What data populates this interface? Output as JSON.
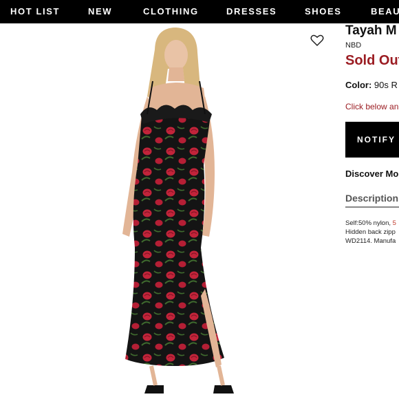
{
  "nav": {
    "items": [
      {
        "label": "HOT LIST"
      },
      {
        "label": "NEW"
      },
      {
        "label": "CLOTHING"
      },
      {
        "label": "DRESSES"
      },
      {
        "label": "SHOES"
      },
      {
        "label": "BEAU"
      }
    ]
  },
  "product": {
    "title": "Tayah M",
    "brand": "NBD",
    "status": "Sold Out",
    "color_label": "Color:",
    "color_value": "90s R",
    "click_note": "Click below an",
    "notify_label": "NOTIFY I",
    "discover_label": "Discover Mo",
    "description_tab": "Description",
    "description_lines": [
      {
        "text": "Self:50% nylon, ",
        "accent": "5"
      },
      {
        "text": "Hidden back zipp",
        "accent": ""
      },
      {
        "text": "WD2114. Manufa",
        "accent": ""
      }
    ]
  },
  "icons": {
    "favorite": "heart-outline-icon"
  },
  "colors": {
    "nav_bg": "#000000",
    "sold_out": "#9b1c22",
    "notify_bg": "#000000",
    "dress_base": "#141414",
    "rose": "#c2243a",
    "leaf": "#3f6b2e"
  }
}
